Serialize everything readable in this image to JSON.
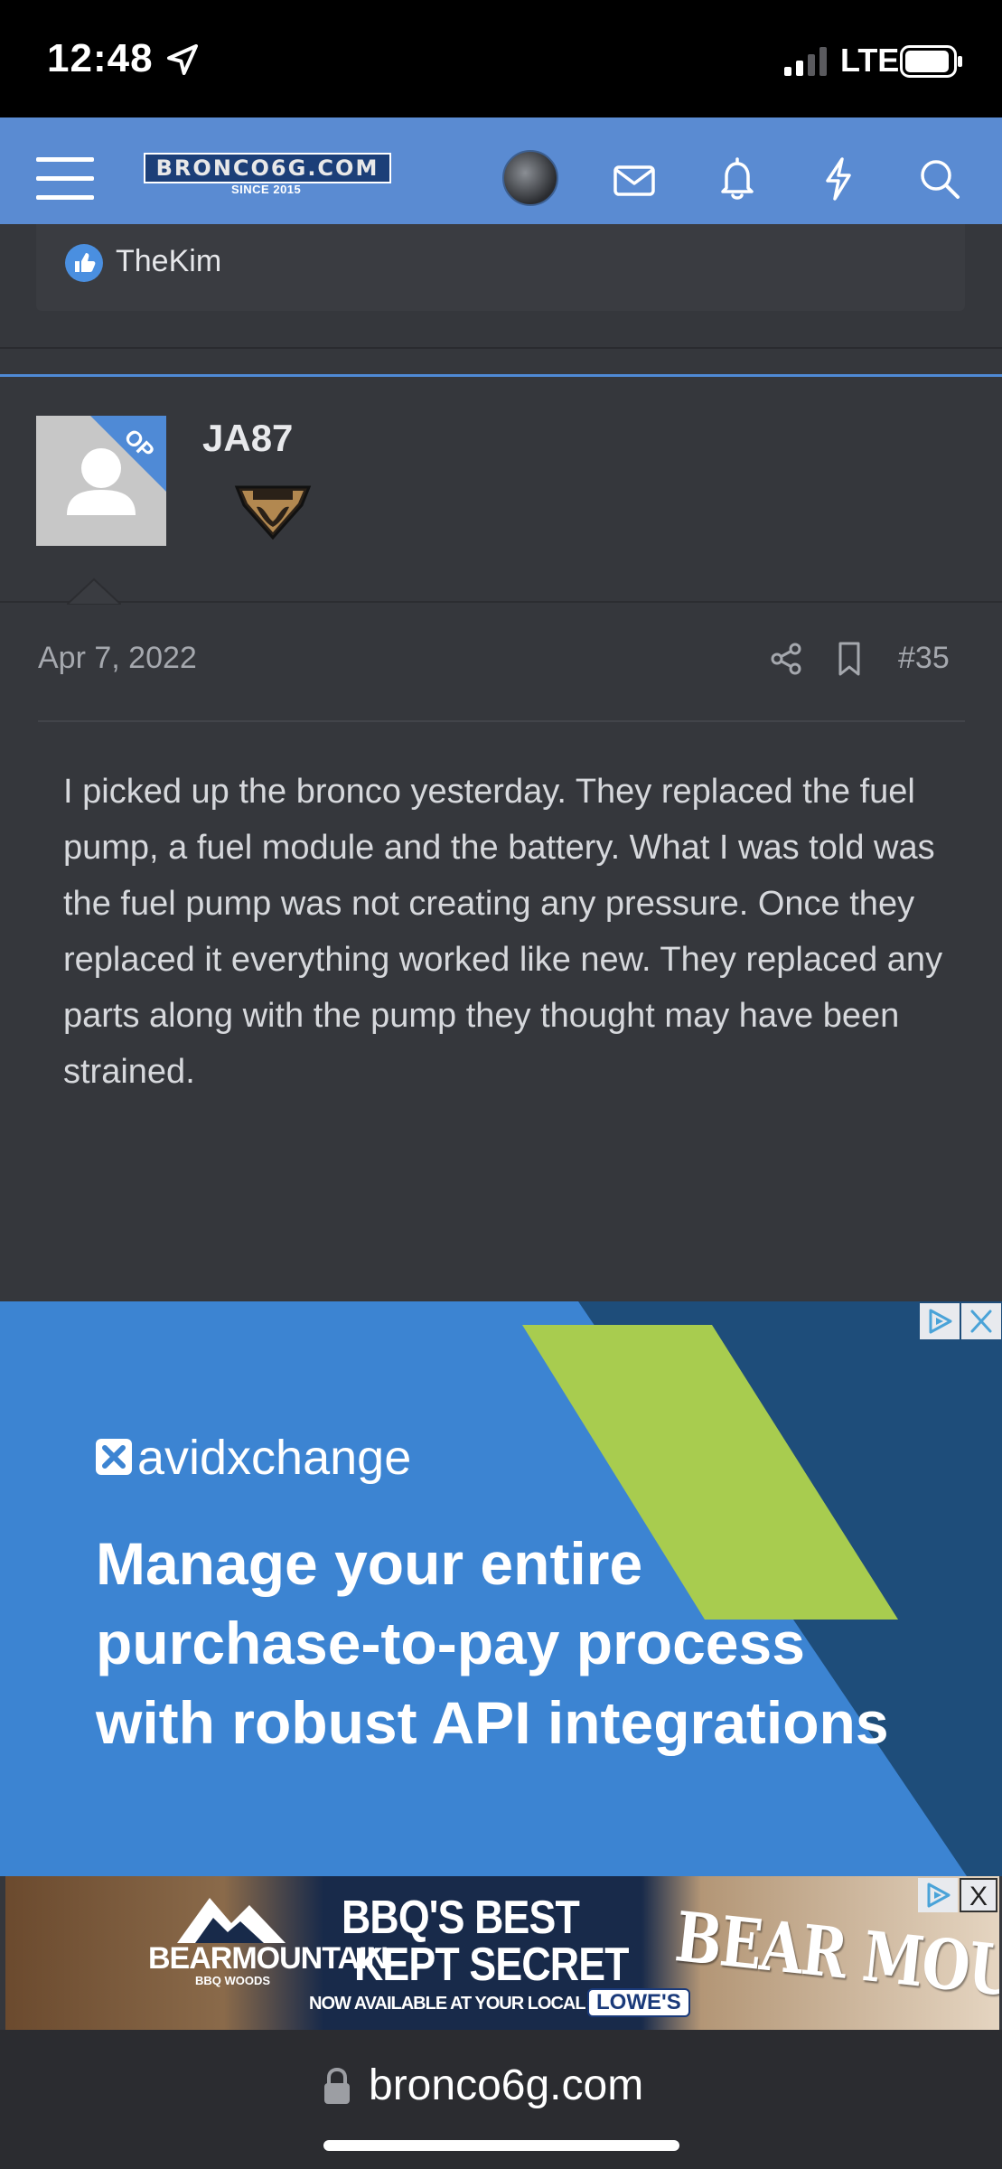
{
  "status_bar": {
    "time": "12:48",
    "network": "LTE"
  },
  "header": {
    "logo_text": "BRONCO6G.COM",
    "logo_tagline": "SINCE 2015"
  },
  "previous_post": {
    "reaction_user": "TheKim"
  },
  "post": {
    "author": "JA87",
    "op_badge": "OP",
    "author_badge_text": "BADLANDS",
    "date": "Apr 7, 2022",
    "number": "#35",
    "body": "I picked up the bronco yesterday. They replaced the fuel pump, a fuel module and the battery. What I was told was the fuel pump was not creating any pressure. Once they replaced it everything worked like new. They replaced any parts along with the pump they thought may have been strained."
  },
  "ad_1": {
    "brand": "avidxchange",
    "headline": "Manage your entire purchase-to-pay process with robust API integrations",
    "close_label": "X",
    "colors": {
      "background": "#3c84d2",
      "accent": "#a8cc4f",
      "dark": "#1e4d7a"
    }
  },
  "ad_2": {
    "brand": "BEARMOUNTAIN",
    "brand_sub": "BBQ WOODS",
    "headline_1": "BBQ'S BEST",
    "headline_2": "KEPT SECRET",
    "availability": "NOW AVAILABLE AT YOUR LOCAL",
    "store": "LOWE'S",
    "big_text": "BEAR MOUN",
    "close_label": "X"
  },
  "browser": {
    "url": "bronco6g.com"
  }
}
